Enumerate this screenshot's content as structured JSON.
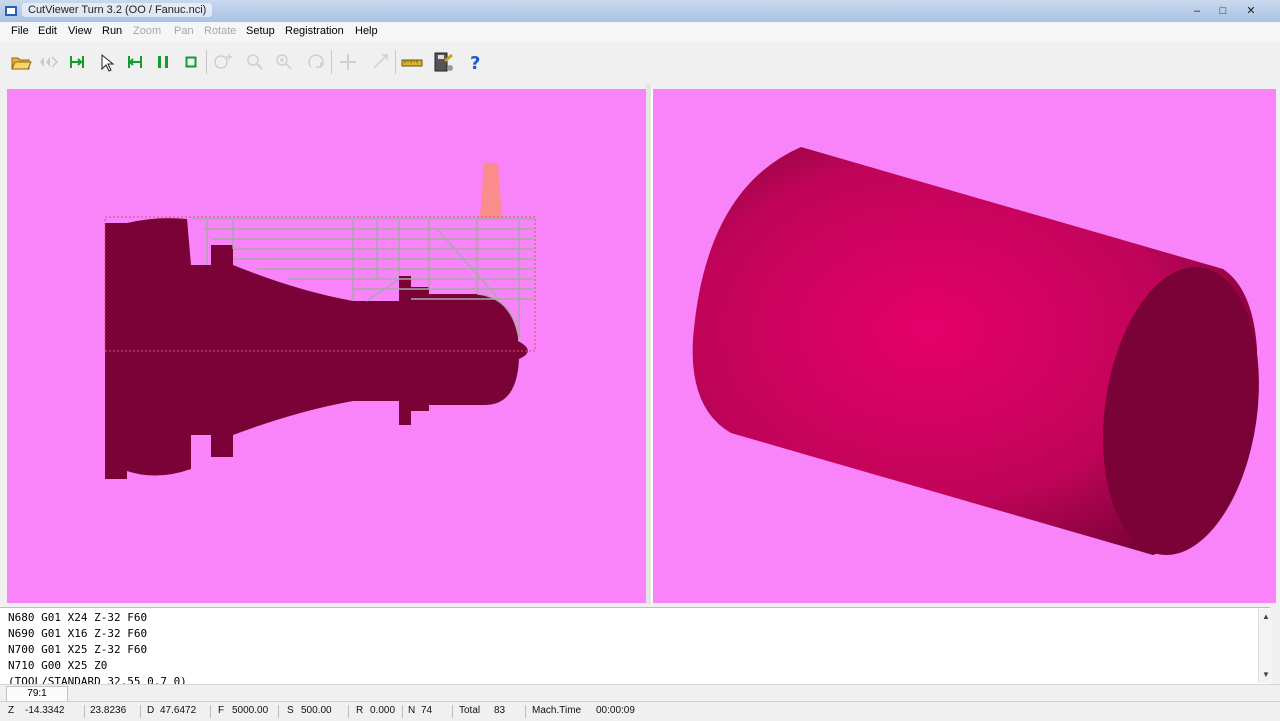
{
  "window": {
    "title": "CutViewer Turn 3.2 (OO / Fanuc.nci)"
  },
  "menu": [
    {
      "label": "File",
      "enabled": true
    },
    {
      "label": "Edit",
      "enabled": true
    },
    {
      "label": "View",
      "enabled": true
    },
    {
      "label": "Run",
      "enabled": true
    },
    {
      "label": "Zoom",
      "enabled": false
    },
    {
      "label": "Pan",
      "enabled": false
    },
    {
      "label": "Rotate",
      "enabled": false
    },
    {
      "label": "Setup",
      "enabled": true
    },
    {
      "label": "Registration",
      "enabled": true
    },
    {
      "label": "Help",
      "enabled": true
    }
  ],
  "toolbar": {
    "icons": [
      "open-file-icon",
      "rewind-icon",
      "step-to-start-icon",
      "single-step-icon",
      "step-to-end-icon",
      "pause-icon",
      "stop-icon",
      "zoom-window-icon",
      "zoom-out-icon",
      "zoom-in-icon",
      "rotate-icon",
      "pan-icon",
      "fit-icon",
      "measure-icon",
      "tool-setup-icon",
      "help-icon"
    ],
    "help_glyph": "?"
  },
  "colors": {
    "viewport_bg": "#f984f9",
    "stock": "#7a0236",
    "stock_3d": "#e6006a",
    "toolpath": "#9b9b9b",
    "tool": "#fa8c8c"
  },
  "gcode": {
    "lines": [
      "N680 G01 X24 Z-32 F60",
      "N690 G01 X16 Z-32 F60",
      "N700 G01 X25 Z-32 F60",
      "N710 G00 X25 Z0",
      "(TOOL/STANDARD 32.55 0.7 0)"
    ]
  },
  "zoom": {
    "value": "79:1"
  },
  "status": {
    "z_label": "Z",
    "z_value": "-14.3342",
    "x_value": "23.8236",
    "d_label": "D",
    "d_value": "47.6472",
    "f_label": "F",
    "f_value": "5000.00",
    "s_label": "S",
    "s_value": "500.00",
    "r_label": "R",
    "r_value": "0.000",
    "n_label": "N",
    "n_value": "74",
    "total_label": "Total",
    "total_value": "83",
    "machtime_label": "Mach.Time",
    "machtime_value": "00:00:09"
  }
}
